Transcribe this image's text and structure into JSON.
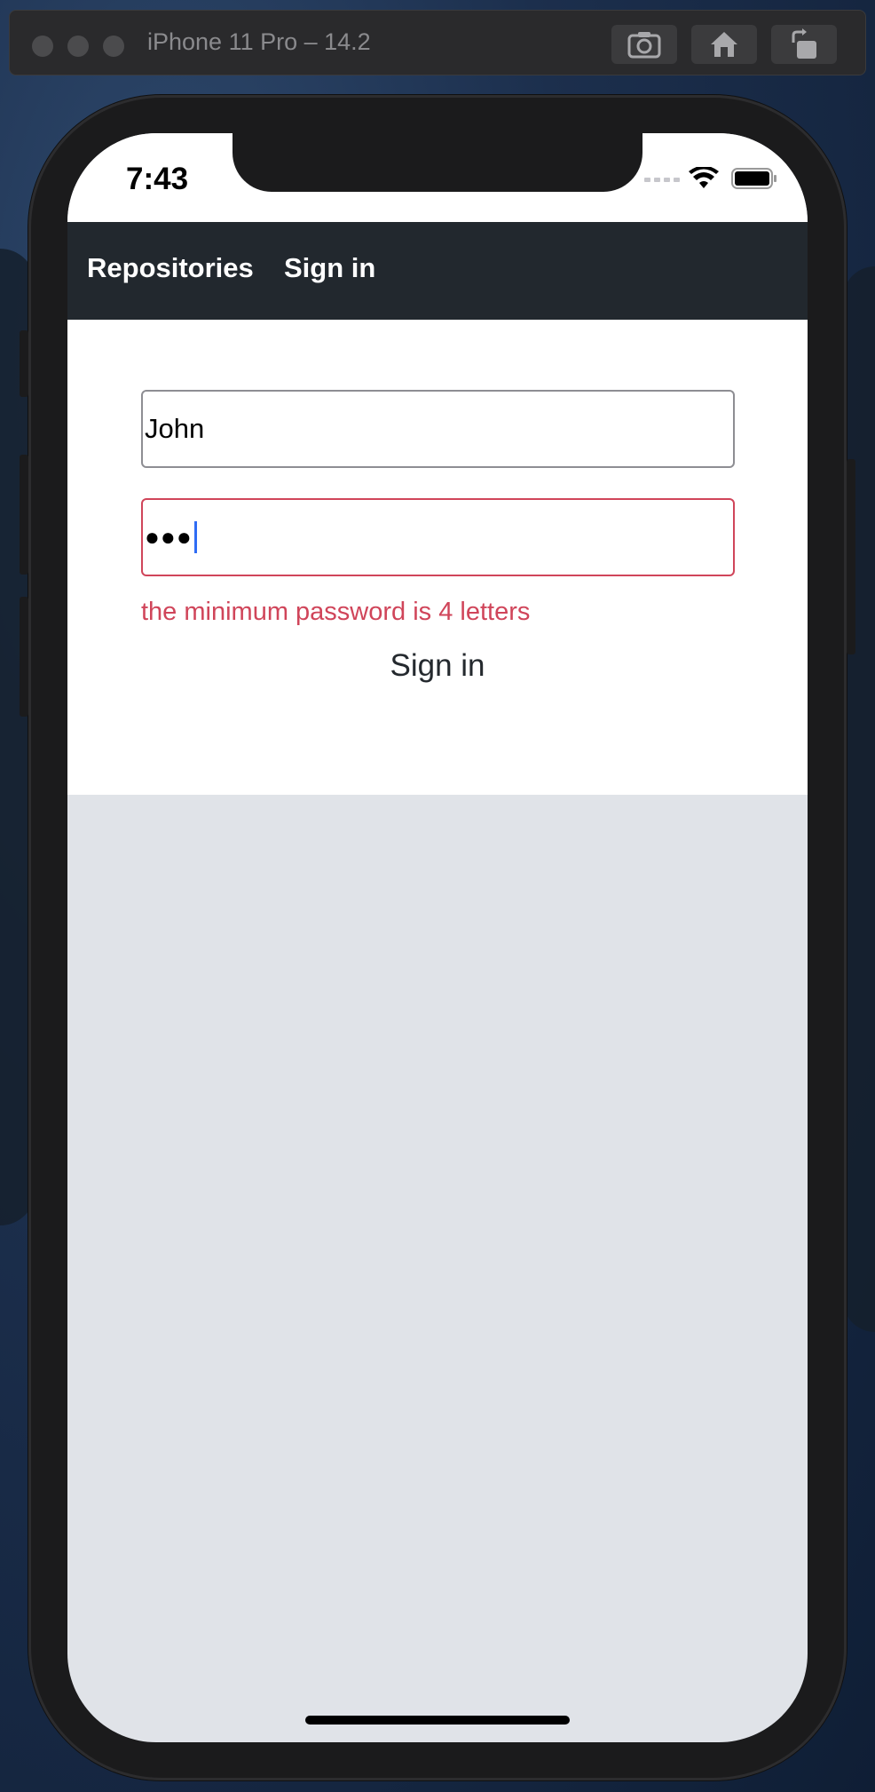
{
  "simulator": {
    "title": "iPhone 11 Pro – 14.2",
    "buttons": [
      "screenshot-icon",
      "home-icon",
      "rotate-icon"
    ]
  },
  "status_bar": {
    "time": "7:43",
    "icons": [
      "signal-icon",
      "wifi-icon",
      "battery-icon"
    ]
  },
  "navbar": {
    "links": [
      {
        "label": "Repositories"
      },
      {
        "label": "Sign in"
      }
    ]
  },
  "form": {
    "username": {
      "value": "John"
    },
    "password": {
      "masked_value": "●●●",
      "state": "error"
    },
    "error_message": "the minimum password is 4 letters",
    "submit_label": "Sign in"
  },
  "colors": {
    "navbar": "#22282e",
    "error": "#d0455a",
    "page_background": "#e0e3e8",
    "caret": "#2f6cf4"
  }
}
